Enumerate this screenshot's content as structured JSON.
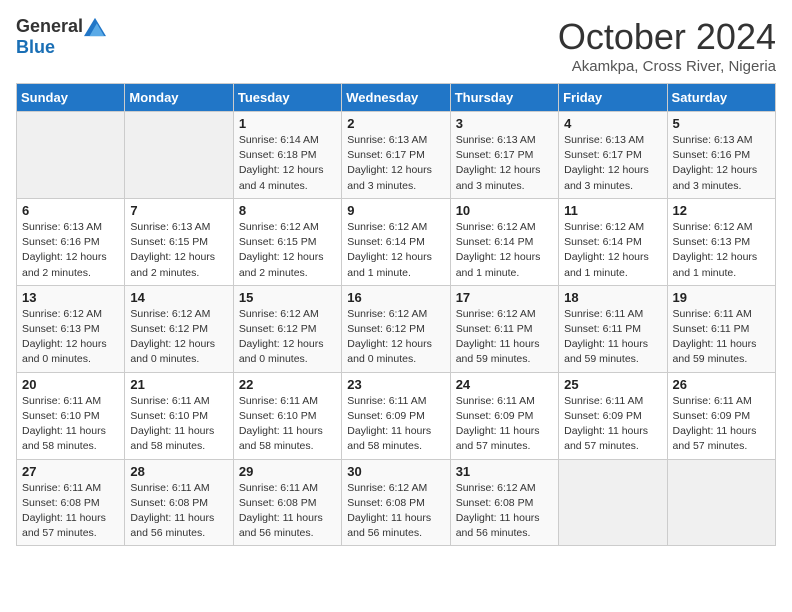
{
  "header": {
    "logo_general": "General",
    "logo_blue": "Blue",
    "month_title": "October 2024",
    "subtitle": "Akamkpa, Cross River, Nigeria"
  },
  "days_of_week": [
    "Sunday",
    "Monday",
    "Tuesday",
    "Wednesday",
    "Thursday",
    "Friday",
    "Saturday"
  ],
  "weeks": [
    [
      {
        "day": "",
        "info": ""
      },
      {
        "day": "",
        "info": ""
      },
      {
        "day": "1",
        "info": "Sunrise: 6:14 AM\nSunset: 6:18 PM\nDaylight: 12 hours and 4 minutes."
      },
      {
        "day": "2",
        "info": "Sunrise: 6:13 AM\nSunset: 6:17 PM\nDaylight: 12 hours and 3 minutes."
      },
      {
        "day": "3",
        "info": "Sunrise: 6:13 AM\nSunset: 6:17 PM\nDaylight: 12 hours and 3 minutes."
      },
      {
        "day": "4",
        "info": "Sunrise: 6:13 AM\nSunset: 6:17 PM\nDaylight: 12 hours and 3 minutes."
      },
      {
        "day": "5",
        "info": "Sunrise: 6:13 AM\nSunset: 6:16 PM\nDaylight: 12 hours and 3 minutes."
      }
    ],
    [
      {
        "day": "6",
        "info": "Sunrise: 6:13 AM\nSunset: 6:16 PM\nDaylight: 12 hours and 2 minutes."
      },
      {
        "day": "7",
        "info": "Sunrise: 6:13 AM\nSunset: 6:15 PM\nDaylight: 12 hours and 2 minutes."
      },
      {
        "day": "8",
        "info": "Sunrise: 6:12 AM\nSunset: 6:15 PM\nDaylight: 12 hours and 2 minutes."
      },
      {
        "day": "9",
        "info": "Sunrise: 6:12 AM\nSunset: 6:14 PM\nDaylight: 12 hours and 1 minute."
      },
      {
        "day": "10",
        "info": "Sunrise: 6:12 AM\nSunset: 6:14 PM\nDaylight: 12 hours and 1 minute."
      },
      {
        "day": "11",
        "info": "Sunrise: 6:12 AM\nSunset: 6:14 PM\nDaylight: 12 hours and 1 minute."
      },
      {
        "day": "12",
        "info": "Sunrise: 6:12 AM\nSunset: 6:13 PM\nDaylight: 12 hours and 1 minute."
      }
    ],
    [
      {
        "day": "13",
        "info": "Sunrise: 6:12 AM\nSunset: 6:13 PM\nDaylight: 12 hours and 0 minutes."
      },
      {
        "day": "14",
        "info": "Sunrise: 6:12 AM\nSunset: 6:12 PM\nDaylight: 12 hours and 0 minutes."
      },
      {
        "day": "15",
        "info": "Sunrise: 6:12 AM\nSunset: 6:12 PM\nDaylight: 12 hours and 0 minutes."
      },
      {
        "day": "16",
        "info": "Sunrise: 6:12 AM\nSunset: 6:12 PM\nDaylight: 12 hours and 0 minutes."
      },
      {
        "day": "17",
        "info": "Sunrise: 6:12 AM\nSunset: 6:11 PM\nDaylight: 11 hours and 59 minutes."
      },
      {
        "day": "18",
        "info": "Sunrise: 6:11 AM\nSunset: 6:11 PM\nDaylight: 11 hours and 59 minutes."
      },
      {
        "day": "19",
        "info": "Sunrise: 6:11 AM\nSunset: 6:11 PM\nDaylight: 11 hours and 59 minutes."
      }
    ],
    [
      {
        "day": "20",
        "info": "Sunrise: 6:11 AM\nSunset: 6:10 PM\nDaylight: 11 hours and 58 minutes."
      },
      {
        "day": "21",
        "info": "Sunrise: 6:11 AM\nSunset: 6:10 PM\nDaylight: 11 hours and 58 minutes."
      },
      {
        "day": "22",
        "info": "Sunrise: 6:11 AM\nSunset: 6:10 PM\nDaylight: 11 hours and 58 minutes."
      },
      {
        "day": "23",
        "info": "Sunrise: 6:11 AM\nSunset: 6:09 PM\nDaylight: 11 hours and 58 minutes."
      },
      {
        "day": "24",
        "info": "Sunrise: 6:11 AM\nSunset: 6:09 PM\nDaylight: 11 hours and 57 minutes."
      },
      {
        "day": "25",
        "info": "Sunrise: 6:11 AM\nSunset: 6:09 PM\nDaylight: 11 hours and 57 minutes."
      },
      {
        "day": "26",
        "info": "Sunrise: 6:11 AM\nSunset: 6:09 PM\nDaylight: 11 hours and 57 minutes."
      }
    ],
    [
      {
        "day": "27",
        "info": "Sunrise: 6:11 AM\nSunset: 6:08 PM\nDaylight: 11 hours and 57 minutes."
      },
      {
        "day": "28",
        "info": "Sunrise: 6:11 AM\nSunset: 6:08 PM\nDaylight: 11 hours and 56 minutes."
      },
      {
        "day": "29",
        "info": "Sunrise: 6:11 AM\nSunset: 6:08 PM\nDaylight: 11 hours and 56 minutes."
      },
      {
        "day": "30",
        "info": "Sunrise: 6:12 AM\nSunset: 6:08 PM\nDaylight: 11 hours and 56 minutes."
      },
      {
        "day": "31",
        "info": "Sunrise: 6:12 AM\nSunset: 6:08 PM\nDaylight: 11 hours and 56 minutes."
      },
      {
        "day": "",
        "info": ""
      },
      {
        "day": "",
        "info": ""
      }
    ]
  ]
}
